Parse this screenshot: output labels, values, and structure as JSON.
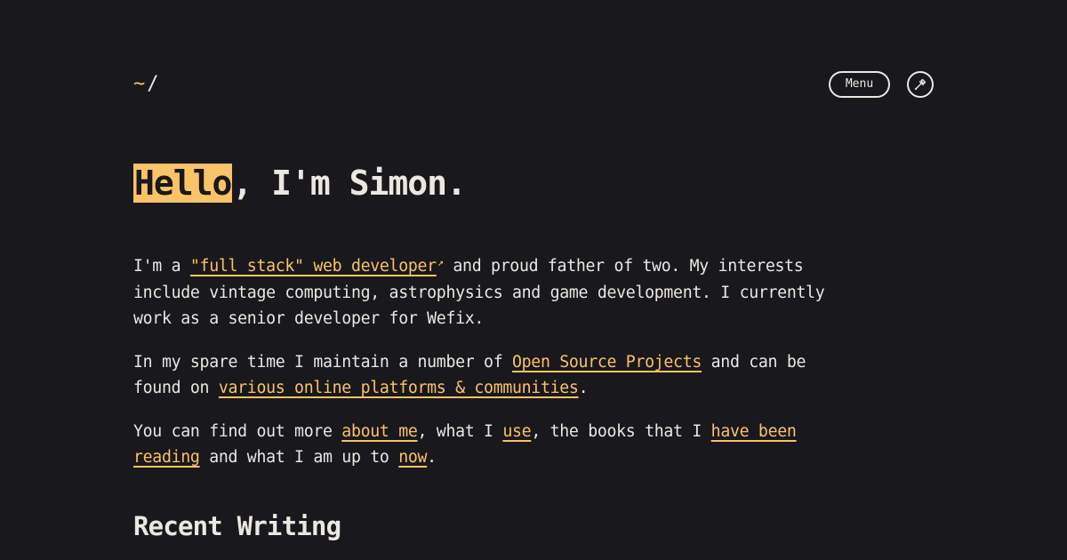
{
  "header": {
    "logo_tilde": "~",
    "logo_slash": "/",
    "menu_label": "Menu",
    "theme_icon": "pipette-icon"
  },
  "hero": {
    "highlight": "Hello",
    "rest": ", I'm Simon."
  },
  "intro": {
    "p1": {
      "t1": "I'm a ",
      "link1": "\"full stack\" web developer",
      "ext": "↗",
      "t2": " and proud father of two. My interests include vintage computing, astrophysics and game development. I currently work as a senior developer for Wefix."
    },
    "p2": {
      "t1": "In my spare time I maintain a number of ",
      "link1": "Open Source Projects",
      "t2": " and can be found on ",
      "link2": "various online platforms & communities",
      "t3": "."
    },
    "p3": {
      "t1": "You can find out more ",
      "link1": "about me",
      "t2": ", what I ",
      "link2": "use",
      "t3": ", the books that I ",
      "link3": "have been reading",
      "t4": " and what I am up to ",
      "link4": "now",
      "t5": "."
    }
  },
  "sections": {
    "recent_writing": "Recent Writing"
  },
  "colors": {
    "background": "#19181d",
    "text": "#ebe7e1",
    "accent": "#f9c367"
  }
}
